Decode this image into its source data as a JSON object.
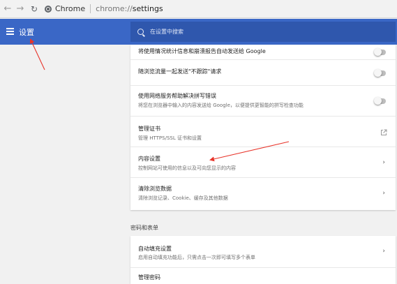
{
  "browser": {
    "site_label": "Chrome",
    "url_host": "chrome://",
    "url_path": "settings"
  },
  "header": {
    "title": "设置",
    "search_placeholder": "在设置中搜索"
  },
  "privacy_rows": [
    {
      "title": "将使用情况统计信息和崩溃报告自动发送给 Google",
      "control": "toggle",
      "enabled": false
    },
    {
      "title": "随浏览流量一起发送\"不跟踪\"请求",
      "control": "toggle",
      "enabled": false
    },
    {
      "title": "使用网络服务帮助解决拼写错误",
      "subtitle": "将您在浏览器中输入的内容发送给 Google，以便提供更智能的拼写检查功能",
      "control": "toggle",
      "enabled": false
    },
    {
      "title": "管理证书",
      "subtitle": "管理 HTTPS/SSL 证书和设置",
      "control": "external-link-icon"
    },
    {
      "title": "内容设置",
      "subtitle": "控制网站可使用的信息以及可向您显示的内容",
      "control": "chevron-right-icon"
    },
    {
      "title": "清除浏览数据",
      "subtitle": "清除浏览记录、Cookie、缓存及其他数据",
      "control": "chevron-right-icon"
    }
  ],
  "passwords_section": {
    "label": "密码和表单",
    "rows": [
      {
        "title": "自动填充设置",
        "subtitle": "启用自动填充功能后，只需点击一次即可填写多个表单",
        "control": "chevron-right-icon"
      },
      {
        "title": "管理密码"
      }
    ]
  },
  "colors": {
    "header_blue": "#3a67c6",
    "search_blue": "#2f57ad",
    "annotation_red": "#e8352b",
    "page_bg": "#f1f1f1"
  }
}
